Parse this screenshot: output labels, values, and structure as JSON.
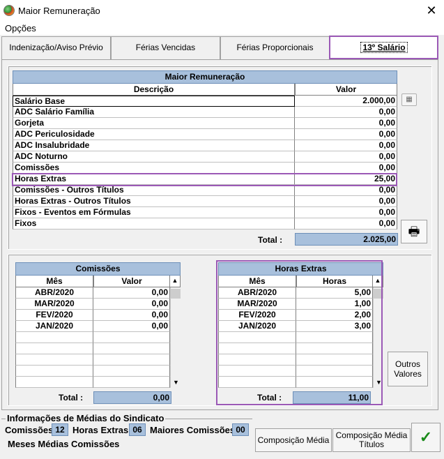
{
  "window": {
    "title": "Maior Remuneração"
  },
  "menu": {
    "opcoes": "Opções"
  },
  "tabs": [
    {
      "label": "Indenização/Aviso Prévio"
    },
    {
      "label": "Férias Vencidas"
    },
    {
      "label": "Férias Proporcionais"
    },
    {
      "label": "13º Salário"
    }
  ],
  "main_grid": {
    "title": "Maior Remuneração",
    "col_descricao": "Descrição",
    "col_valor": "Valor",
    "rows": [
      {
        "descricao": "Salário Base",
        "valor": "2.000,00"
      },
      {
        "descricao": "ADC Salário Família",
        "valor": "0,00"
      },
      {
        "descricao": "Gorjeta",
        "valor": "0,00"
      },
      {
        "descricao": "ADC Periculosidade",
        "valor": "0,00"
      },
      {
        "descricao": "ADC Insalubridade",
        "valor": "0,00"
      },
      {
        "descricao": "ADC Noturno",
        "valor": "0,00"
      },
      {
        "descricao": "Comissões",
        "valor": "0,00"
      },
      {
        "descricao": "Horas Extras",
        "valor": "25,00"
      },
      {
        "descricao": "Comissões - Outros Títulos",
        "valor": "0,00"
      },
      {
        "descricao": "Horas Extras - Outros Títulos",
        "valor": "0,00"
      },
      {
        "descricao": "Fixos - Eventos em Fórmulas",
        "valor": "0,00"
      },
      {
        "descricao": "Fixos",
        "valor": "0,00"
      }
    ],
    "total_label": "Total :",
    "total_value": "2.025,00"
  },
  "comissoes": {
    "title": "Comissões",
    "col_mes": "Mês",
    "col_valor": "Valor",
    "rows": [
      {
        "mes": "ABR/2020",
        "valor": "0,00"
      },
      {
        "mes": "MAR/2020",
        "valor": "0,00"
      },
      {
        "mes": "FEV/2020",
        "valor": "0,00"
      },
      {
        "mes": "JAN/2020",
        "valor": "0,00"
      }
    ],
    "total_label": "Total :",
    "total_value": "0,00"
  },
  "horas_extras": {
    "title": "Horas Extras",
    "col_mes": "Mês",
    "col_horas": "Horas",
    "rows": [
      {
        "mes": "ABR/2020",
        "horas": "5,00"
      },
      {
        "mes": "MAR/2020",
        "horas": "1,00"
      },
      {
        "mes": "FEV/2020",
        "horas": "2,00"
      },
      {
        "mes": "JAN/2020",
        "horas": "3,00"
      }
    ],
    "total_label": "Total :",
    "total_value": "11,00"
  },
  "buttons": {
    "outros_valores_1": "Outros",
    "outros_valores_2": "Valores",
    "composicao_media": "Composição Média",
    "composicao_titulos_1": "Composição Média",
    "composicao_titulos_2": "Títulos",
    "ok": "✓"
  },
  "sindicato": {
    "title": "Informações de Médias do Sindicato",
    "comissoes_label": "Comissões",
    "comissoes_value": "12",
    "horas_extras_label": "Horas Extras",
    "horas_extras_value": "06",
    "maiores_comissoes_label": "Maiores Comissões",
    "maiores_comissoes_value": "00",
    "meses_medias_label": "Meses Médias Comissões"
  },
  "icons": {
    "close": "close-icon",
    "app": "app-icon",
    "calculator": "calculator-icon",
    "printer": "printer-icon",
    "check": "check-icon"
  }
}
